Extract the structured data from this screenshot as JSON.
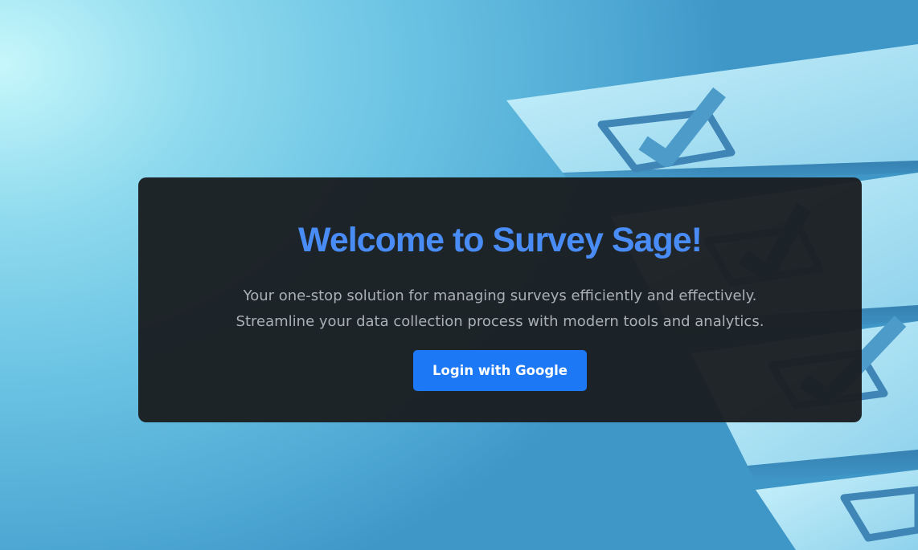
{
  "hero": {
    "title": "Welcome to Survey Sage!",
    "description_line1": "Your one-stop solution for managing surveys efficiently and effectively.",
    "description_line2": "Streamline your data collection process with modern tools and analytics.",
    "login_label": "Login with Google"
  },
  "colors": {
    "title": "#4a8cf5",
    "button": "#1c78f4",
    "card": "#1b1f22",
    "text": "#a9b0b6"
  },
  "background_image": {
    "icon": "checklist-checkbox-icon"
  }
}
